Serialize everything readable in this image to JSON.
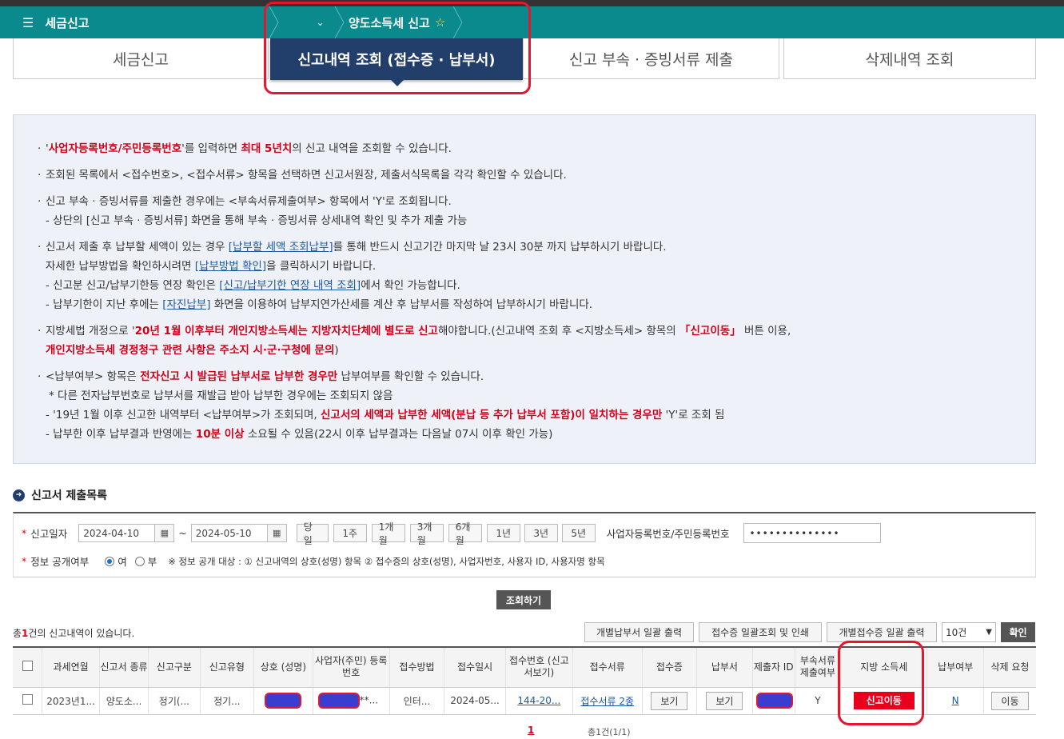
{
  "nav": {
    "menu_label": "세금신고",
    "sub_label": "",
    "breadcrumb": "양도소득세 신고"
  },
  "tabs": [
    {
      "label": "세금신고"
    },
    {
      "label": "신고내역 조회 (접수증 · 납부서)"
    },
    {
      "label": "신고 부속 · 증빙서류 제출"
    },
    {
      "label": "삭제내역 조회"
    }
  ],
  "info": {
    "g1_pre": "'",
    "g1_red1": "사업자등록번호/주민등록번호",
    "g1_mid": "'를 입력하면 ",
    "g1_red2": "최대 5년치",
    "g1_post": "의 신고 내역을 조회할 수 있습니다.",
    "g2": "조회된 목록에서 <접수번호>, <접수서류> 항목을 선택하면 신고서원장, 제출서식목록을 각각 확인할 수 있습니다.",
    "g3a": "신고 부속 · 증빙서류를 제출한 경우에는 <부속서류제출여부> 항목에서 'Y'로 조회됩니다.",
    "g3b": "- 상단의 [신고 부속 · 증빙서류] 화면을 통해 부속 · 증빙서류 상세내역 확인 및 추가 제출 가능",
    "g4a_pre": "신고서 제출 후 납부할 세액이 있는 경우 ",
    "g4a_link": "[납부할 세액 조회납부]",
    "g4a_post": "를 통해 반드시 신고기간 마지막 날 23시 30분 까지 납부하시기 바랍니다.",
    "g4b_pre": "자세한 납부방법을 확인하시려면 ",
    "g4b_link": "[납부방법 확인]",
    "g4b_post": "을 클릭하시기 바랍니다.",
    "g4c_pre": "- 신고분 신고/납부기한등 연장 확인은 ",
    "g4c_link": "[신고/납부기한 연장 내역 조회]",
    "g4c_post": "에서 확인 가능합니다.",
    "g4d_pre": "- 납부기한이 지난 후에는 ",
    "g4d_link": "[자진납부]",
    "g4d_post": " 화면을 이용하여 납부지연가산세를 계산 후 납부서를 작성하여 납부하시기 바랍니다.",
    "g5a_pre": "지방세법 개정으로 '",
    "g5a_red": "20년 1월 이후부터 개인지방소득세는 지방자치단체에 별도로 신고",
    "g5a_mid": "해야합니다.(신고내역 조회 후 <지방소득세> 항목의 ",
    "g5a_red2": "「신고이동」",
    "g5a_post": " 버튼 이용,",
    "g5b_red": "개인지방소득세 경정청구 관련 사항은 주소지 시·군·구청에 문의",
    "g5b_post": ")",
    "g6a_pre": "<납부여부> 항목은 ",
    "g6a_red": "전자신고 시 발급된 납부서로 납부한 경우만",
    "g6a_post": " 납부여부를 확인할 수 있습니다.",
    "g6b": "* 다른 전자납부번호로 납부서를 재발급 받아 납부한 경우에는 조회되지 않음",
    "g6c_pre": "- '19년 1월 이후 신고한 내역부터 <납부여부>가 조회되며, ",
    "g6c_red": "신고서의 세액과 납부한 세액(분납 등 추가 납부서 포함)이 일치하는 경우만",
    "g6c_post": " 'Y'로 조회 됨",
    "g6d_pre": "- 납부한 이후 납부결과 반영에는 ",
    "g6d_red": "10분 이상",
    "g6d_post": " 소요될 수 있음(22시 이후 납부결과는 다음날 07시 이후 확인 가능)"
  },
  "section_title": "신고서 제출목록",
  "search": {
    "date_label": "신고일자",
    "date_from": "2024-04-10",
    "date_sep": "~",
    "date_to": "2024-05-10",
    "periods": [
      "당일",
      "1주",
      "1개월",
      "3개월",
      "6개월",
      "1년",
      "3년",
      "5년"
    ],
    "id_label": "사업자등록번호/주민등록번호",
    "id_value": "••••••••••••••",
    "public_label": "정보 공개여부",
    "opt_yes": "여",
    "opt_no": "부",
    "public_note": "※ 정보 공개 대상 : ① 신고내역의 상호(성명) 항목 ② 접수증의 상호(성명), 사업자번호, 사용자 ID, 사용자명 항목",
    "query_button": "조회하기"
  },
  "list": {
    "count_pre": "총",
    "count_num": "1",
    "count_post": "건의 신고내역이 있습니다.",
    "btn_payment": "개별납부서 일괄 출력",
    "btn_receipt_print": "접수증 일괄조회 및 인쇄",
    "btn_receipt_each": "개별접수증 일괄 출력",
    "page_size": "10건",
    "confirm": "확인",
    "headers": [
      "과세연월",
      "신고서 종류",
      "신고구분",
      "신고유형",
      "상호 (성명)",
      "사업자(주민) 등록번호",
      "접수방법",
      "접수일시",
      "접수번호 (신고서보기)",
      "접수서류",
      "접수증",
      "납부서",
      "제출자 ID",
      "부속서류 제출여부",
      "지방 소득세",
      "납부여부",
      "삭제 요청"
    ],
    "row": {
      "period": "2023년1...",
      "kind": "양도소...",
      "category": "정기(...",
      "type": "정기...",
      "regno_suffix": "**...",
      "method": "인터...",
      "datetime": "2024-05...",
      "receipt_no": "144-20...",
      "docs": "접수서류 2종",
      "receipt_btn": "보기",
      "payment_btn": "보기",
      "attach": "Y",
      "local_btn": "신고이동",
      "paid": "N",
      "delete_btn": "이동"
    },
    "page_current": "1",
    "page_info": "총1건(1/1)"
  },
  "colors": {
    "navbar": "#0b8a8e",
    "active_tab": "#223f6c",
    "highlight": "#e6162e",
    "red_text": "#d0021b",
    "link": "#1a5aa6"
  }
}
